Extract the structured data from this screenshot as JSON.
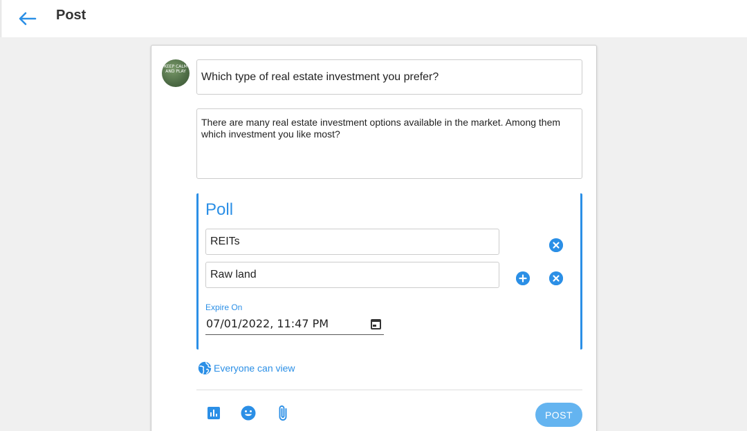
{
  "header": {
    "back_icon": "arrow-left-icon",
    "title": "Post"
  },
  "post": {
    "avatar_text": "KEEP CALM AND PLAY",
    "title_value": "Which type of real estate investment you prefer?",
    "description_value": "There are many real estate investment options available in the market. Among them which investment you like most?"
  },
  "poll": {
    "title": "Poll",
    "options": [
      {
        "value": "REITs"
      },
      {
        "value": "Raw land"
      }
    ],
    "expire_label": "Expire On",
    "expire_value": "07/01/2022, 11:47 PM"
  },
  "visibility": {
    "icon": "globe-icon",
    "label": "Everyone can view"
  },
  "toolbar": {
    "icons": [
      "poll-chart-icon",
      "emoji-icon",
      "attachment-icon"
    ],
    "post_label": "POST"
  },
  "colors": {
    "accent": "#2b8fe6",
    "post_button": "#64b4f0",
    "background": "#f0f0f0"
  }
}
